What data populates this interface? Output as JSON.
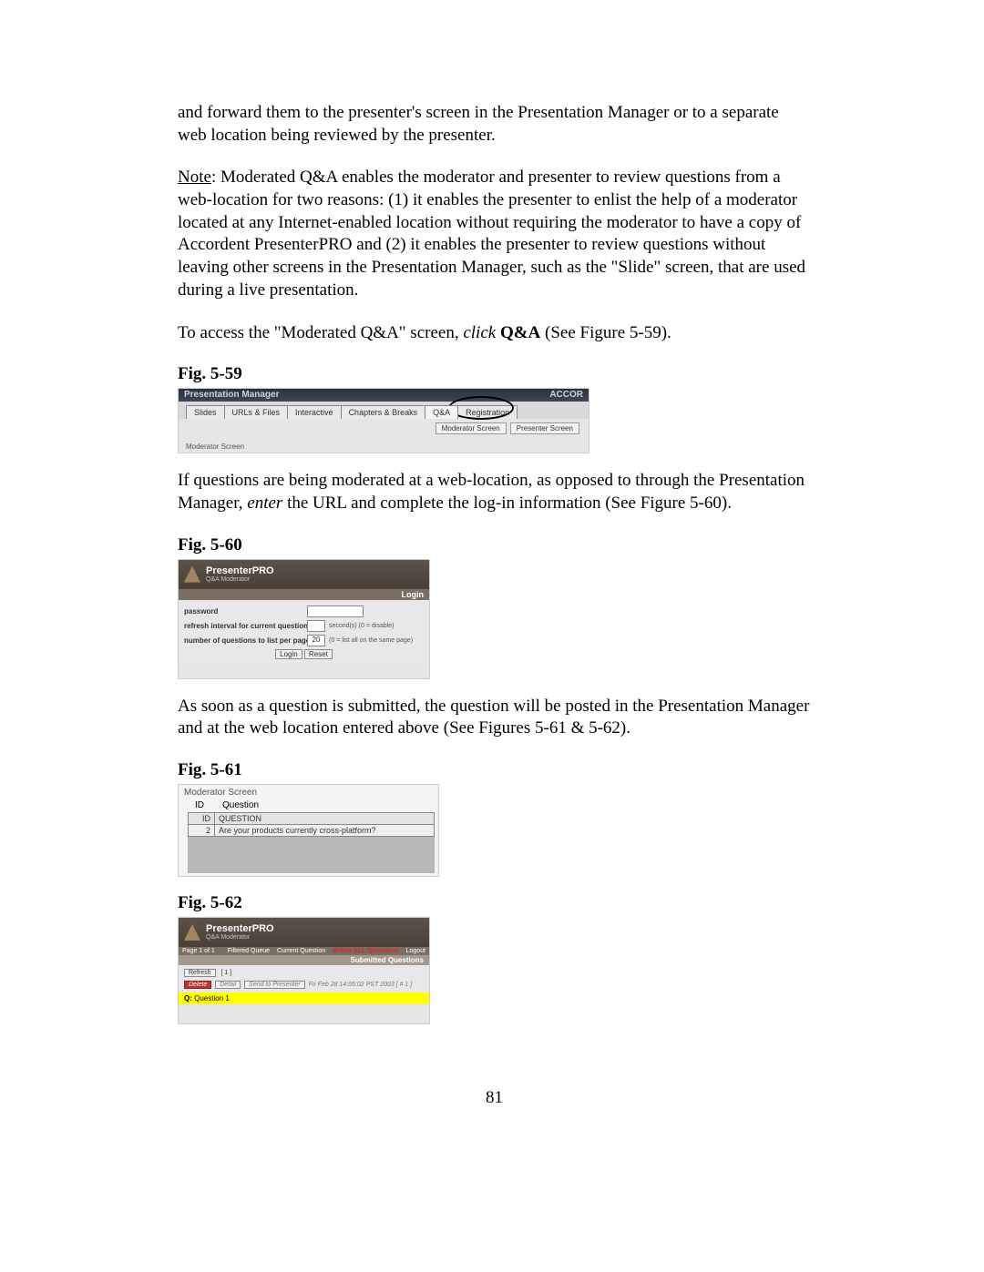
{
  "paragraphs": {
    "p1": "and forward them to the presenter's screen in the Presentation Manager or to a separate web location being reviewed by the presenter.",
    "p2_prefix": "Note",
    "p2_rest": ": Moderated Q&A enables the moderator and presenter to review questions from a web-location for two reasons: (1) it enables the presenter to enlist the help of a moderator located at any Internet-enabled location without requiring the moderator to have a copy of Accordent PresenterPRO and (2) it enables the presenter to review questions without leaving other screens in the Presentation Manager, such as the \"Slide\" screen, that are used during a live presentation.",
    "p3_a": "To access the \"Moderated Q&A\" screen, ",
    "p3_i": "click ",
    "p3_b": "Q&A",
    "p3_c": " (See Figure 5-59).",
    "p4_a": "If questions are being moderated at a web-location, as opposed to through the Presentation Manager, ",
    "p4_i": "enter",
    "p4_b": " the URL and complete the log-in information (See Figure 5-60).",
    "p5": "As soon as a question is submitted, the question will be posted in the Presentation Manager and at the web location entered above (See Figures 5-61 & 5-62)."
  },
  "fig_labels": {
    "f59": "Fig. 5-59",
    "f60": "Fig. 5-60",
    "f61": "Fig. 5-61",
    "f62": "Fig. 5-62"
  },
  "fig59": {
    "title_left": "Presentation Manager",
    "title_right": "ACCOR",
    "tabs": [
      "Slides",
      "URLs & Files",
      "Interactive",
      "Chapters & Breaks",
      "Q&A",
      "Registration"
    ],
    "sub_buttons": [
      "Moderator Screen",
      "Presenter Screen"
    ],
    "moderator_label": "Moderator Screen"
  },
  "fig60": {
    "app_name": "PresenterPRO",
    "app_sub": "Q&A Moderator",
    "login_label": "Login",
    "rows": {
      "password": "password",
      "refresh": "refresh interval for current question",
      "refresh_hint": "second(s) (0 = disable)",
      "perpage": "number of questions to list per page",
      "perpage_value": "20",
      "perpage_hint": "(0 = list all on the same page)"
    },
    "buttons": {
      "login": "Login",
      "reset": "Reset"
    }
  },
  "fig61": {
    "top_label": "Moderator Screen",
    "header_id": "ID",
    "header_q": "Question",
    "th_id": "ID",
    "th_q": "QUESTION",
    "row_id": "2",
    "row_q": "Are your products currently cross-platform?"
  },
  "fig62": {
    "app_name": "PresenterPRO",
    "app_sub": "Q&A Moderator",
    "page_label": "Page 1 of 1",
    "nav": {
      "filtered": "Filtered Queue",
      "current": "Current Question",
      "delete": "Delete ALL Questions",
      "logout": "Logout"
    },
    "submitted": "Submitted Questions",
    "refresh_btn": "Refresh",
    "pager": "[ 1 ]",
    "delete_btn": "Delete",
    "detail_btn": "Detail",
    "send_btn": "Send to Presenter",
    "timestamp": "Fri Feb 28 14:05:02 PST 2003  [ # 1 ]",
    "q_label": "Q:",
    "q_text": " Question 1"
  },
  "page_number": "81"
}
